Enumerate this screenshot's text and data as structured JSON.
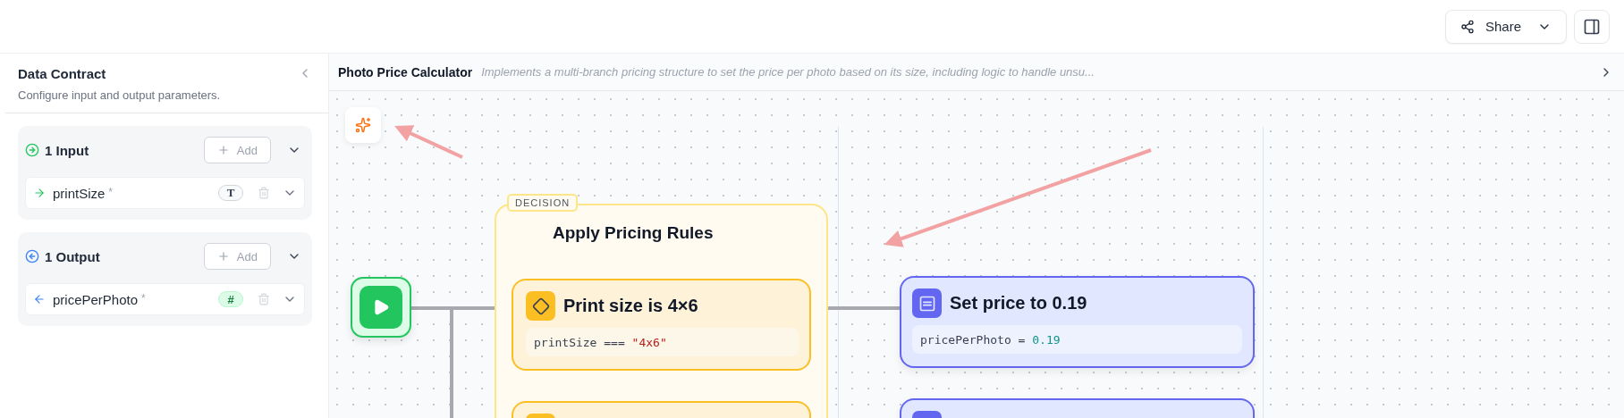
{
  "top_bar": {
    "share_button": {
      "label": "Share"
    }
  },
  "data_contract": {
    "title": "Data Contract",
    "subtitle": "Configure input and output parameters.",
    "sections": [
      {
        "kind": "input",
        "heading": "1 Input",
        "add_label": "Add",
        "params": [
          {
            "name": "printSize",
            "required_mark": "*",
            "kind": "text",
            "type_glyph": "T"
          }
        ]
      },
      {
        "kind": "output",
        "heading": "1 Output",
        "add_label": "Add",
        "params": [
          {
            "name": "pricePerPhoto",
            "required_mark": "*",
            "kind": "number",
            "type_glyph": "#"
          }
        ]
      }
    ]
  },
  "canvas": {
    "title": "Photo Price Calculator",
    "description": "Implements a multi-branch pricing structure to set the price per photo based on its size, including logic to handle unsu...",
    "decision": {
      "tag": "DECISION",
      "title": "Apply Pricing Rules",
      "conditions": [
        {
          "kind": "condition",
          "title": "Print size is 4×6",
          "expression": "printSize ===",
          "literal": "\"4x6\""
        },
        {
          "kind": "condition"
        }
      ]
    },
    "actions": [
      {
        "kind": "assign",
        "title": "Set price to 0.19",
        "target": "pricePerPhoto =",
        "value": "0.19"
      },
      {
        "kind": "assign"
      }
    ]
  }
}
